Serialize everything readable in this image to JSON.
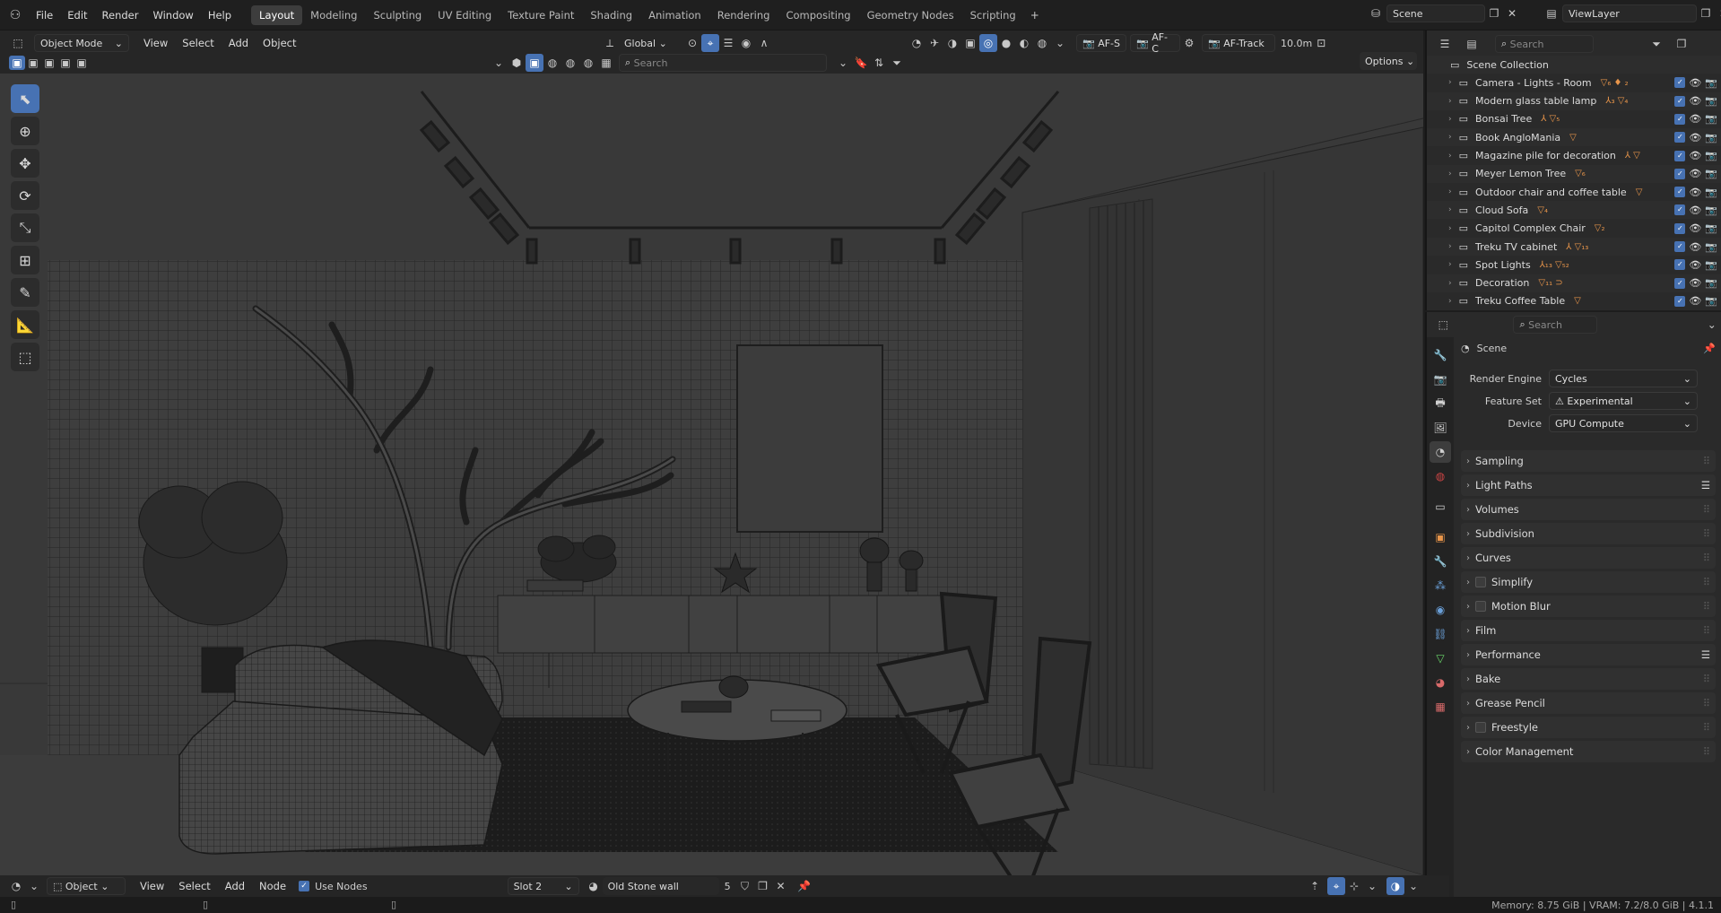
{
  "menus": [
    "File",
    "Edit",
    "Render",
    "Window",
    "Help"
  ],
  "workspaces": [
    "Layout",
    "Modeling",
    "Sculpting",
    "UV Editing",
    "Texture Paint",
    "Shading",
    "Animation",
    "Rendering",
    "Compositing",
    "Geometry Nodes",
    "Scripting"
  ],
  "active_workspace": "Layout",
  "plus_label": "+",
  "scene": {
    "name": "Scene",
    "view_layer": "ViewLayer"
  },
  "viewport_header": {
    "mode": "Object Mode",
    "menus": [
      "View",
      "Select",
      "Add",
      "Object"
    ],
    "orientation": "Global",
    "search_placeholder": "Search",
    "options_label": "Options",
    "af_s": "AF-S",
    "af_c": "AF-C",
    "af_track": "AF-Track",
    "distance": "10.0m"
  },
  "outliner": {
    "search_placeholder": "Search",
    "root": "Scene Collection",
    "items": [
      {
        "name": "Camera - Lights - Room",
        "badge": "▽₆ ♦ ₂"
      },
      {
        "name": "Modern glass table lamp",
        "badge": "⅄₃ ▽₄"
      },
      {
        "name": "Bonsai Tree",
        "badge": "⅄ ▽₅"
      },
      {
        "name": "Book AngloMania",
        "badge": "▽"
      },
      {
        "name": "Magazine pile for decoration",
        "badge": "⅄ ▽"
      },
      {
        "name": "Meyer Lemon Tree",
        "badge": "▽₆"
      },
      {
        "name": "Outdoor chair and coffee table",
        "badge": "▽"
      },
      {
        "name": "Cloud Sofa",
        "badge": "▽₄"
      },
      {
        "name": "Capitol Complex Chair",
        "badge": "▽₂"
      },
      {
        "name": "Treku TV cabinet",
        "badge": "⅄ ▽₁₃"
      },
      {
        "name": "Spot Lights",
        "badge": "⅄₁₃ ▽₅₂"
      },
      {
        "name": "Decoration",
        "badge": "▽₁₁ ⊃"
      },
      {
        "name": "Treku Coffee Table",
        "badge": "▽"
      }
    ]
  },
  "properties": {
    "search_placeholder": "Search",
    "context": "Scene",
    "render_engine_label": "Render Engine",
    "render_engine": "Cycles",
    "feature_set_label": "Feature Set",
    "feature_set": "Experimental",
    "device_label": "Device",
    "device": "GPU Compute",
    "panels": [
      {
        "label": "Sampling",
        "checkbox": false,
        "list": false
      },
      {
        "label": "Light Paths",
        "checkbox": false,
        "list": true
      },
      {
        "label": "Volumes",
        "checkbox": false,
        "list": false
      },
      {
        "label": "Subdivision",
        "checkbox": false,
        "list": false
      },
      {
        "label": "Curves",
        "checkbox": false,
        "list": false
      },
      {
        "label": "Simplify",
        "checkbox": true,
        "list": false
      },
      {
        "label": "Motion Blur",
        "checkbox": true,
        "list": false
      },
      {
        "label": "Film",
        "checkbox": false,
        "list": false
      },
      {
        "label": "Performance",
        "checkbox": false,
        "list": true
      },
      {
        "label": "Bake",
        "checkbox": false,
        "list": false
      },
      {
        "label": "Grease Pencil",
        "checkbox": false,
        "list": false
      },
      {
        "label": "Freestyle",
        "checkbox": true,
        "list": false
      },
      {
        "label": "Color Management",
        "checkbox": false,
        "list": false
      }
    ]
  },
  "node_header": {
    "object_label": "Object",
    "menus": [
      "View",
      "Select",
      "Add",
      "Node"
    ],
    "use_nodes_label": "Use Nodes",
    "slot": "Slot 2",
    "material": "Old Stone wall",
    "users": "5"
  },
  "status": {
    "memory": "Memory: 8.75 GiB | VRAM: 7.2/8.0 GiB | 4.1.1"
  },
  "colors": {
    "accent": "#4772b3",
    "orange": "#e8954a",
    "bg": "#1d1d1d"
  }
}
